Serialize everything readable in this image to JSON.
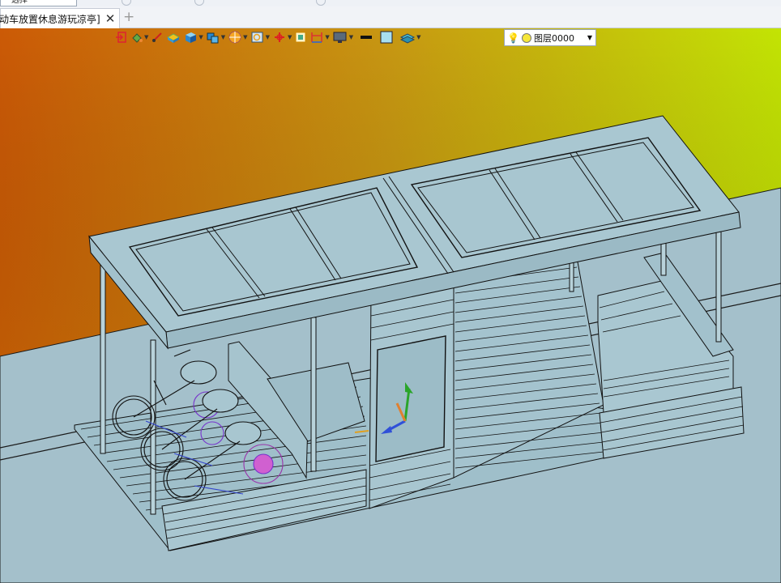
{
  "window": {
    "selector_text": "一选择"
  },
  "tabs": [
    {
      "label": "动车放置休息游玩凉亭]",
      "close": "✕"
    }
  ],
  "new_tab": "+",
  "toolbar": {
    "tools": [
      {
        "icon": "exit-icon"
      },
      {
        "icon": "paint-bucket-icon",
        "dropdown": true
      },
      {
        "icon": "line-tool-icon"
      },
      {
        "icon": "block-icon"
      },
      {
        "icon": "cube-icon",
        "dropdown": true
      },
      {
        "icon": "multi-cube-icon",
        "dropdown": true
      },
      {
        "icon": "render-sphere-icon",
        "dropdown": true
      },
      {
        "icon": "zoom-view-icon",
        "dropdown": true
      },
      {
        "icon": "axis-icon",
        "dropdown": true
      },
      {
        "icon": "frame-icon"
      },
      {
        "icon": "dimension-icon",
        "dropdown": true
      },
      {
        "icon": "display-monitor-icon",
        "dropdown": true
      },
      {
        "icon": "line-color-icon"
      },
      {
        "icon": "fill-color-icon"
      },
      {
        "icon": "layer-stack-icon",
        "dropdown": true
      }
    ],
    "layer": {
      "name": "图层0000",
      "dropdown_arrow": "▼"
    }
  },
  "viewport": {
    "background_top_left": "#cc5a06",
    "background_top_right": "#c3e404",
    "ground_color": "#a4c0cb",
    "model_color": "#a8c6d0",
    "model_name": "凉亭"
  }
}
